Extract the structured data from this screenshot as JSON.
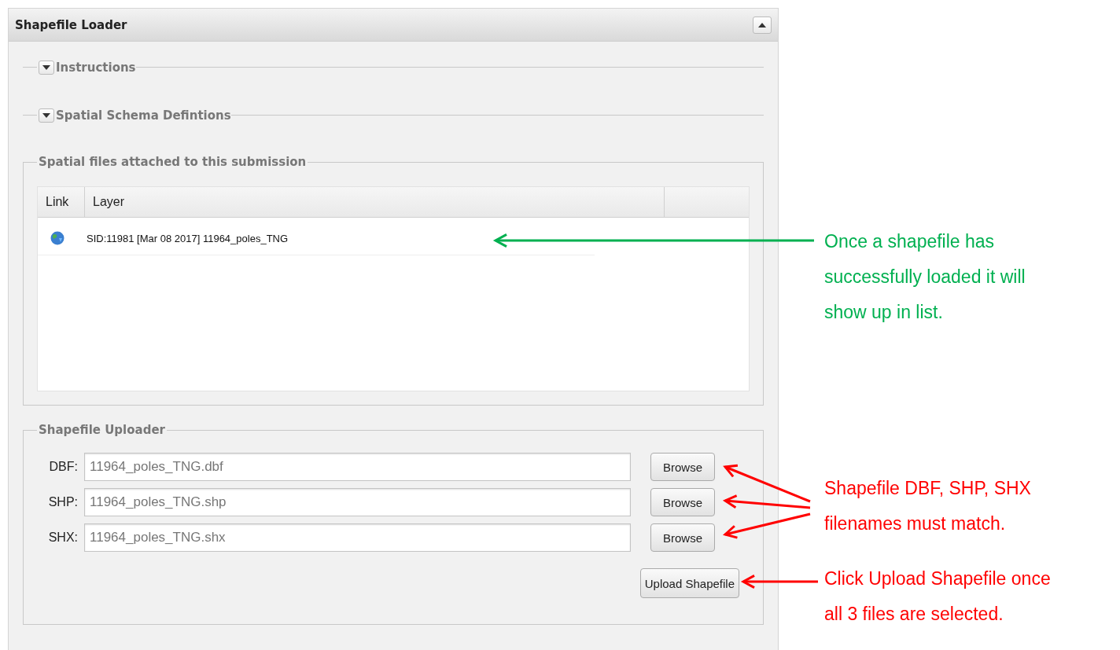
{
  "panel": {
    "title": "Shapefile Loader",
    "expanded": true
  },
  "sections": [
    {
      "title": "Instructions",
      "expanded": false
    },
    {
      "title": "Spatial Schema Defintions",
      "expanded": false
    }
  ],
  "files": {
    "title": "Spatial files attached to this submission",
    "columns": [
      "Link",
      "Layer"
    ],
    "rows": [
      {
        "layer": "SID:11981 [Mar 08 2017] 11964_poles_TNG"
      }
    ]
  },
  "uploader": {
    "title": "Shapefile Uploader",
    "fields": [
      {
        "label": "DBF:",
        "value": "11964_poles_TNG.dbf",
        "button": "Browse"
      },
      {
        "label": "SHP:",
        "value": "11964_poles_TNG.shp",
        "button": "Browse"
      },
      {
        "label": "SHX:",
        "value": "11964_poles_TNG.shx",
        "button": "Browse"
      }
    ],
    "submit": "Upload Shapefile"
  },
  "annotations": [
    {
      "text": "Once a shapefile has successfully loaded it will show up in list.",
      "color": "#00b050"
    },
    {
      "text": "Shapefile DBF, SHP, SHX filenames must match.",
      "color": "#ff0000"
    },
    {
      "text": "Click Upload Shapefile once all 3 files are selected.",
      "color": "#ff0000"
    }
  ]
}
